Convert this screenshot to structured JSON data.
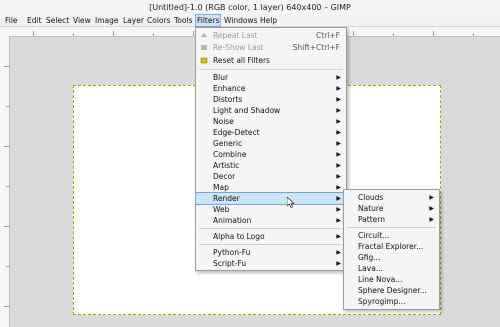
{
  "window": {
    "title": "[Untitled]-1.0 (RGB color, 1 layer) 640x400 – GIMP"
  },
  "menubar": {
    "items": [
      "File",
      "Edit",
      "Select",
      "View",
      "Image",
      "Layer",
      "Colors",
      "Tools",
      "Filters",
      "Windows",
      "Help"
    ],
    "active": "Filters"
  },
  "filters_menu": {
    "top": [
      {
        "label": "Repeat Last",
        "shortcut": "Ctrl+F",
        "icon": "repeat-icon"
      },
      {
        "label": "Re-Show Last",
        "shortcut": "Shift+Ctrl+F",
        "icon": "reshow-icon"
      },
      {
        "label": "Reset all Filters",
        "icon": "reset-icon"
      }
    ],
    "groups": [
      "Blur",
      "Enhance",
      "Distorts",
      "Light and Shadow",
      "Noise",
      "Edge-Detect",
      "Generic",
      "Combine",
      "Artistic",
      "Decor",
      "Map",
      "Render",
      "Web",
      "Animation"
    ],
    "alpha": "Alpha to Logo",
    "scripts": [
      "Python-Fu",
      "Script-Fu"
    ]
  },
  "render_menu": {
    "groups": [
      "Clouds",
      "Nature",
      "Pattern"
    ],
    "items": [
      "Circuit...",
      "Fractal Explorer...",
      "Gfig...",
      "Lava...",
      "Line Nova...",
      "Sphere Designer...",
      "Spyrogimp..."
    ]
  },
  "colors": {
    "highlight": "#cce4f7",
    "image_border": "#a9a100"
  }
}
